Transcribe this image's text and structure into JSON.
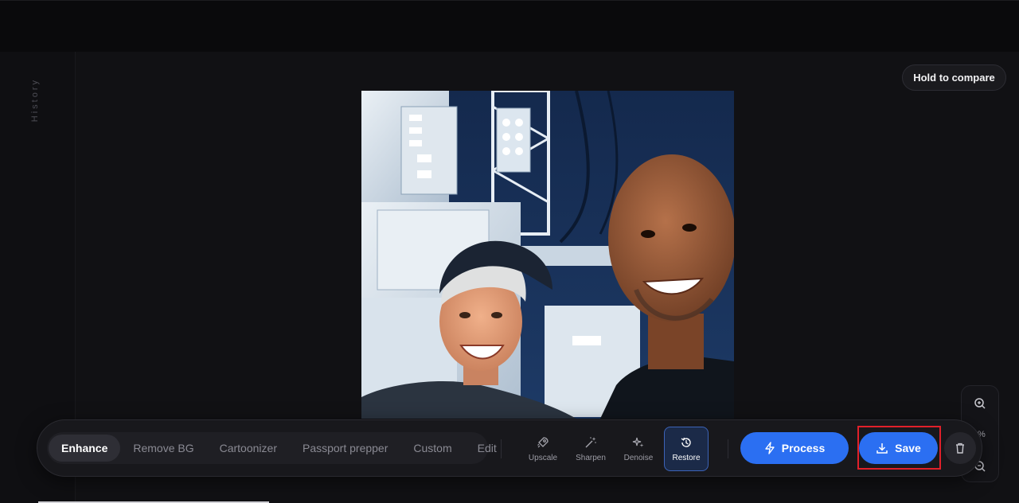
{
  "history": {
    "label": "History"
  },
  "compare": {
    "label": "Hold to compare"
  },
  "zoom": {
    "percent": "%"
  },
  "modes": [
    {
      "label": "Enhance",
      "active": true
    },
    {
      "label": "Remove BG",
      "active": false
    },
    {
      "label": "Cartoonizer",
      "active": false
    },
    {
      "label": "Passport prepper",
      "active": false
    },
    {
      "label": "Custom",
      "active": false
    },
    {
      "label": "Edit",
      "active": false
    }
  ],
  "tools": [
    {
      "label": "Upscale",
      "icon": "rocket-icon",
      "active": false
    },
    {
      "label": "Sharpen",
      "icon": "magic-wand-icon",
      "active": false
    },
    {
      "label": "Denoise",
      "icon": "sparkle-icon",
      "active": false
    },
    {
      "label": "Restore",
      "icon": "history-icon",
      "active": true
    }
  ],
  "actions": {
    "process_label": "Process",
    "save_label": "Save"
  },
  "colors": {
    "accent": "#2b6ff2",
    "highlight": "#e0202a"
  }
}
